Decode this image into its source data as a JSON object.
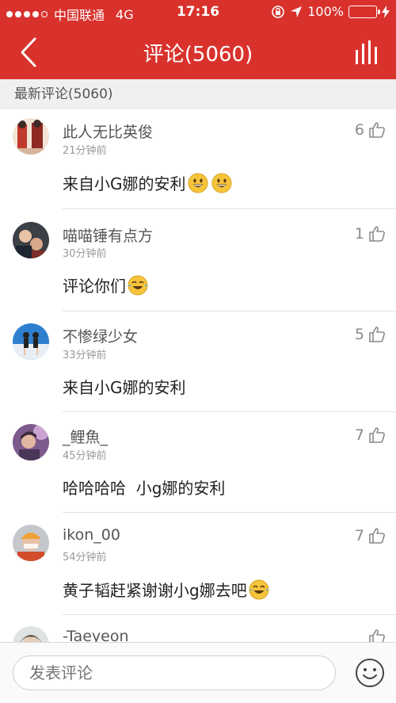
{
  "status_bar": {
    "carrier": "中国联通",
    "network": "4G",
    "time": "17:16",
    "battery_text": "100%",
    "battery_color": "#4cd964",
    "icons": [
      "signal-dots-icon",
      "orientation-lock-icon",
      "location-arrow-icon",
      "battery-icon",
      "charging-bolt-icon"
    ]
  },
  "nav": {
    "title": "评论(5060)",
    "back_icon": "chevron-left-icon",
    "chart_icon": "bar-chart-icon",
    "background": "#d9322d"
  },
  "section": {
    "label": "最新评论(5060)"
  },
  "comments": [
    {
      "user": "此人无比英俊",
      "time": "21分钟前",
      "likes": "6",
      "text": "来自小G娜的安利",
      "emoji_count": 2,
      "emoji": "grinning-face"
    },
    {
      "user": "喵喵锤有点方",
      "time": "30分钟前",
      "likes": "1",
      "text": "评论你们",
      "emoji_count": 1,
      "emoji": "laughing-tears-face"
    },
    {
      "user": "不惨绿少女",
      "time": "33分钟前",
      "likes": "5",
      "text": "来自小G娜的安利",
      "emoji_count": 0,
      "emoji": ""
    },
    {
      "user": "_鲤魚_",
      "time": "45分钟前",
      "likes": "7",
      "text": "哈哈哈哈  小g娜的安利",
      "emoji_count": 0,
      "emoji": ""
    },
    {
      "user": "ikon_00",
      "time": "54分钟前",
      "likes": "7",
      "text": "黄子韬赶紧谢谢小g娜去吧",
      "emoji_count": 1,
      "emoji": "laughing-tears-face"
    },
    {
      "user": "-Taeyeon",
      "time": "",
      "likes": "",
      "text": "",
      "emoji_count": 0,
      "emoji": ""
    }
  ],
  "bottom": {
    "input_placeholder": "发表评论",
    "emoji_button_icon": "smiley-face-icon"
  }
}
